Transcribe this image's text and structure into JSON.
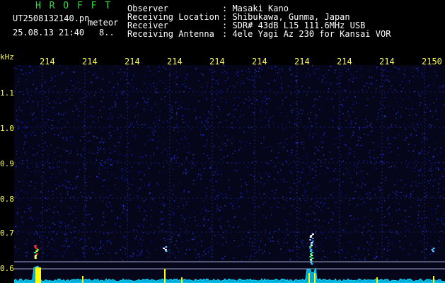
{
  "app": {
    "title": "H R O F F T"
  },
  "file_info": {
    "filename": "UT2508132140.pn",
    "timestamp": "25.08.13 21:40",
    "tag": "meteor",
    "count": "8.."
  },
  "station": {
    "rows": [
      {
        "label": "Observer",
        "value": ": Masaki Kano"
      },
      {
        "label": "Receiving Location",
        "value": ": Shibukawa, Gunma, Japan"
      },
      {
        "label": "Receiver",
        "value": ": SDR# 43dB L15 111.6MHz USB"
      },
      {
        "label": "Receiving Antenna",
        "value": ": 4ele Yagi Az 230 for Kansai VOR"
      }
    ]
  },
  "axes": {
    "unit": "kHz",
    "x_ticks": [
      "214",
      "214",
      "214",
      "214",
      "214",
      "214",
      "214",
      "214",
      "214",
      "2150"
    ],
    "y_ticks": [
      "1.1",
      "1.0",
      "0.9",
      "0.8",
      "0.7",
      "0.6"
    ]
  },
  "colors": {
    "text": "#ffffff",
    "title": "#2fe03a",
    "axis": "#ffff44",
    "background": "#000000",
    "noise": "#1a22a8",
    "spectrum": "#00e0ff",
    "signal": "#ffff00"
  }
}
